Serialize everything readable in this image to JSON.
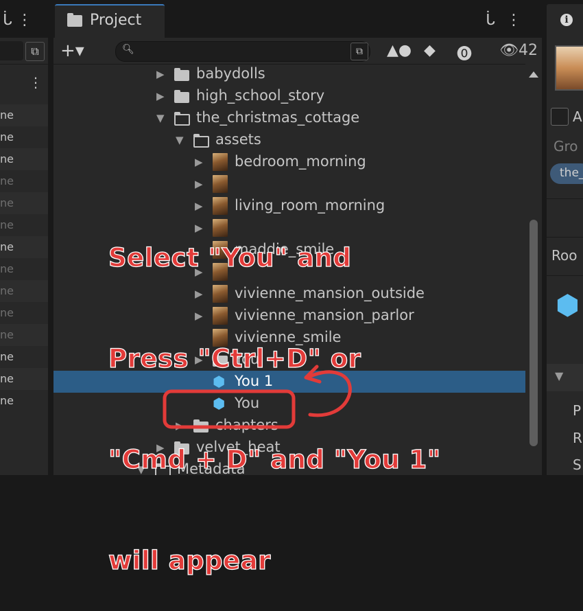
{
  "left_panel": {
    "tab_icons": "ᒑ ⋮",
    "field_button_glyph": "⧉",
    "kebab_glyph": "⋮",
    "rows": [
      {
        "text": "ne",
        "dim": false
      },
      {
        "text": "ne",
        "dim": false
      },
      {
        "text": "ne",
        "dim": false
      },
      {
        "text": "ne",
        "dim": true
      },
      {
        "text": "ne",
        "dim": true
      },
      {
        "text": "ne",
        "dim": true
      },
      {
        "text": "ne",
        "dim": false
      },
      {
        "text": "ne",
        "dim": true
      },
      {
        "text": "ne",
        "dim": true
      },
      {
        "text": "ne",
        "dim": true
      },
      {
        "text": "ne",
        "dim": true
      },
      {
        "text": "ne",
        "dim": false
      },
      {
        "text": "ne",
        "dim": false
      },
      {
        "text": "ne",
        "dim": false
      }
    ]
  },
  "project": {
    "tab_label": "Project",
    "tab_actions": "ᒑ⋮",
    "create_button": "+▾",
    "search_placeholder": "",
    "hidden_count": "👁42",
    "tree": [
      {
        "label": "babydolls",
        "arrow": "▶",
        "icon": "folder",
        "selected": false
      },
      {
        "label": "high_school_story",
        "arrow": "▶",
        "icon": "folder",
        "selected": false
      },
      {
        "label": "the_christmas_cottage",
        "arrow": "▼",
        "icon": "folder-open",
        "selected": false
      },
      {
        "label": "assets",
        "arrow": "▼",
        "icon": "folder-open",
        "selected": false
      },
      {
        "label": "bedroom_morning",
        "arrow": "▶",
        "icon": "image",
        "selected": false
      },
      {
        "label": "",
        "arrow": "▶",
        "icon": "image",
        "selected": false
      },
      {
        "label": "living_room_morning",
        "arrow": "▶",
        "icon": "image",
        "selected": false
      },
      {
        "label": "",
        "arrow": "▶",
        "icon": "image",
        "selected": false
      },
      {
        "label": "maddie_smile",
        "arrow": "",
        "icon": "image",
        "selected": false
      },
      {
        "label": "",
        "arrow": "▶",
        "icon": "image",
        "selected": false
      },
      {
        "label": "vivienne_mansion_outside",
        "arrow": "▶",
        "icon": "image",
        "selected": false
      },
      {
        "label": "vivienne_mansion_parlor",
        "arrow": "▶",
        "icon": "image",
        "selected": false
      },
      {
        "label": "vivienne_smile",
        "arrow": "",
        "icon": "image",
        "selected": false
      },
      {
        "label": "You",
        "arrow": "▶",
        "icon": "folder",
        "selected": false
      },
      {
        "label": "You 1",
        "arrow": "",
        "icon": "prefab",
        "selected": true
      },
      {
        "label": "You",
        "arrow": "",
        "icon": "prefab",
        "selected": false
      },
      {
        "label": "chapters",
        "arrow": "▶",
        "icon": "folder",
        "selected": false
      },
      {
        "label": "velvet_heat",
        "arrow": "▶",
        "icon": "folder",
        "selected": false
      },
      {
        "label": "Metadata",
        "arrow": "▼",
        "icon": "folder-open",
        "selected": false
      }
    ]
  },
  "annotation": {
    "lines": [
      "Select \"You\" and",
      "Press \"Ctrl+D\" or",
      "\"Cmd + D\" and \"You 1\"",
      "will appear"
    ],
    "color": "#e23b39"
  },
  "inspector": {
    "info_glyph": "i",
    "checkbox_label": "A",
    "group_label": "Gro",
    "pill_text": "the_",
    "root_label": "Roo",
    "row_labels": [
      "P",
      "R",
      "S"
    ]
  },
  "colors": {
    "selection": "#2c5d87",
    "prefab_icon": "#5cbcf0",
    "tab_underline": "#3a79bb"
  }
}
